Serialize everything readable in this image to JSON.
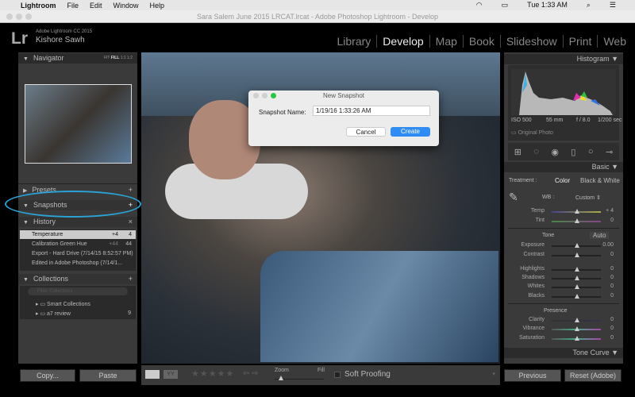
{
  "menubar": {
    "apple": "",
    "app": "Lightroom",
    "items": [
      "File",
      "Edit",
      "Window",
      "Help"
    ],
    "clock": "Tue 1:33 AM"
  },
  "window": {
    "title": "Sara Salem June 2015 LRCAT.lrcat - Adobe Photoshop Lightroom - Develop"
  },
  "identity": {
    "logo": "Lr",
    "product": "Adobe Lightroom CC 2015",
    "user": "Kishore Sawh"
  },
  "modules": [
    "Library",
    "Develop",
    "Map",
    "Book",
    "Slideshow",
    "Print",
    "Web"
  ],
  "navigator": {
    "title": "Navigator",
    "zoom": [
      "FIT",
      "FILL",
      "1:1",
      "1:2"
    ]
  },
  "presets": {
    "title": "Presets"
  },
  "snapshots": {
    "title": "Snapshots"
  },
  "history": {
    "title": "History",
    "items": [
      {
        "name": "Temperature",
        "a": "+4",
        "b": "4"
      },
      {
        "name": "Calibration Green Hue",
        "a": "+44",
        "b": "44"
      },
      {
        "name": "Export - Hard Drive (7/14/15 8:52:57 PM)",
        "a": "",
        "b": ""
      },
      {
        "name": "Edited in Adobe Photoshop (7/14/1...",
        "a": "",
        "b": ""
      }
    ]
  },
  "collections": {
    "title": "Collections",
    "search_placeholder": "Filter Collections",
    "items": [
      {
        "name": "Smart Collections",
        "count": ""
      },
      {
        "name": "a7 review",
        "count": "9"
      }
    ]
  },
  "left_buttons": {
    "copy": "Copy...",
    "paste": "Paste"
  },
  "dialog": {
    "title": "New Snapshot",
    "label": "Snapshot Name:",
    "value": "1/19/16 1:33:26 AM",
    "cancel": "Cancel",
    "create": "Create"
  },
  "toolbar": {
    "zoom": "Zoom",
    "fill": "Fill",
    "soft_proofing": "Soft Proofing"
  },
  "histogram": {
    "title": "Histogram",
    "iso": "ISO 500",
    "focal": "55 mm",
    "aperture": "f / 8.0",
    "shutter": "1/200 sec",
    "original": "Original Photo"
  },
  "basic": {
    "title": "Basic",
    "treatment": "Treatment :",
    "color": "Color",
    "bw": "Black & White",
    "wb": "WB :",
    "wb_value": "Custom",
    "temp": {
      "label": "Temp",
      "value": "+ 4"
    },
    "tint": {
      "label": "Tint",
      "value": "0"
    },
    "tone": "Tone",
    "auto": "Auto",
    "sliders": [
      {
        "label": "Exposure",
        "value": "0.00"
      },
      {
        "label": "Contrast",
        "value": "0"
      },
      {
        "label": "Highlights",
        "value": "0"
      },
      {
        "label": "Shadows",
        "value": "0"
      },
      {
        "label": "Whites",
        "value": "0"
      },
      {
        "label": "Blacks",
        "value": "0"
      }
    ],
    "presence": "Presence",
    "presence_sliders": [
      {
        "label": "Clarity",
        "value": "0"
      },
      {
        "label": "Vibrance",
        "value": "0"
      },
      {
        "label": "Saturation",
        "value": "0"
      }
    ]
  },
  "tone_curve": {
    "title": "Tone Curve"
  },
  "right_buttons": {
    "previous": "Previous",
    "reset": "Reset (Adobe)"
  },
  "colors": {
    "accent": "#2f8cf5",
    "highlight_ellipse": "#2aa3d6"
  }
}
